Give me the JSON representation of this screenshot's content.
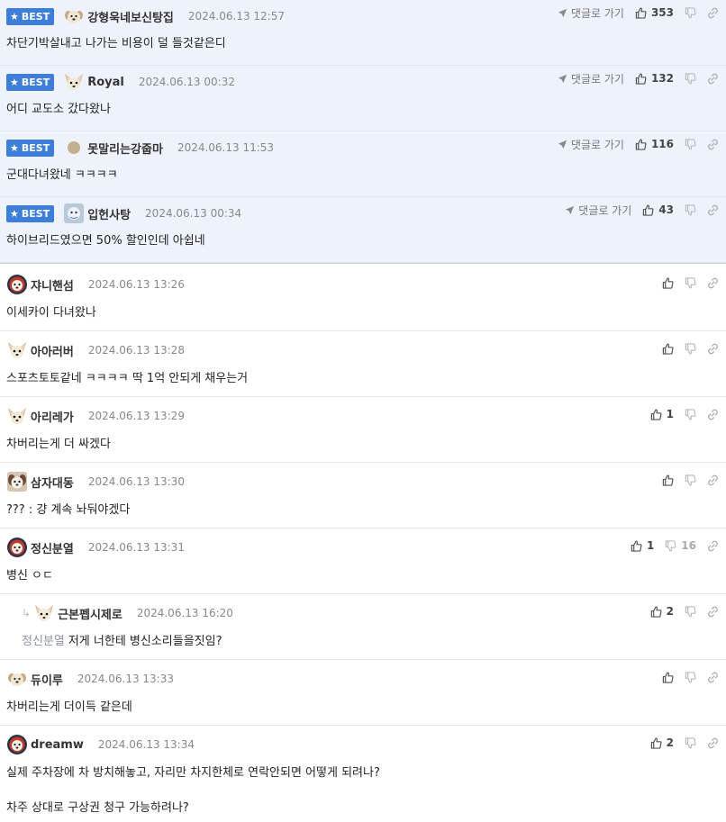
{
  "best_badge": "BEST",
  "goto_reply_label": "댓글로 가기",
  "best_comments": [
    {
      "nick": "강형욱네보신탕집",
      "date": "2024.06.13 12:57",
      "text": "차단기박살내고 나가는 비용이 덜 들것같은디",
      "likes": "353",
      "avatar": "puppy-avatar"
    },
    {
      "nick": "Royal",
      "date": "2024.06.13 00:32",
      "text": "어디 교도소 갔다왔나",
      "likes": "132",
      "avatar": "chihuahua-avatar"
    },
    {
      "nick": "못말리는강줍마",
      "date": "2024.06.13 11:53",
      "text": "군대다녀왔네 ㅋㅋㅋㅋ",
      "likes": "116",
      "avatar": "circle-avatar"
    },
    {
      "nick": "입헌사탕",
      "date": "2024.06.13 00:34",
      "text": "하이브리드였으면 50% 할인인데 아쉽네",
      "likes": "43",
      "avatar": "photo-avatar"
    }
  ],
  "comments": [
    {
      "nick": "쟈니핸섬",
      "date": "2024.06.13 13:26",
      "text": "이세카이 다녀왔나",
      "likes": "",
      "dislikes": "",
      "avatar": "lion-avatar"
    },
    {
      "nick": "아아러버",
      "date": "2024.06.13 13:28",
      "text": "스포츠토토같네 ㅋㅋㅋㅋ 딱 1억 안되게 채우는거",
      "likes": "",
      "dislikes": "",
      "avatar": "chihuahua-avatar"
    },
    {
      "nick": "아리레가",
      "date": "2024.06.13 13:29",
      "text": "차버리는게 더 싸겠다",
      "likes": "1",
      "dislikes": "",
      "avatar": "chihuahua-avatar"
    },
    {
      "nick": "삼자대동",
      "date": "2024.06.13 13:30",
      "text": "??? : 걍 계속 놔둬야겠다",
      "likes": "",
      "dislikes": "",
      "avatar": "dog-photo-avatar"
    },
    {
      "nick": "정신분열",
      "date": "2024.06.13 13:31",
      "text": "병신 ㅇㄷ",
      "likes": "1",
      "dislikes": "16",
      "avatar": "lion-avatar"
    },
    {
      "nick": "근본펩시제로",
      "date": "2024.06.13 16:20",
      "text": "저게 너한테 병신소리들을짓임?",
      "mention": "정신분열",
      "likes": "2",
      "dislikes": "",
      "avatar": "chihuahua-avatar",
      "reply": true
    },
    {
      "nick": "듀이루",
      "date": "2024.06.13 13:33",
      "text": "차버리는게 더이득 같은데",
      "likes": "",
      "dislikes": "",
      "avatar": "puppy-avatar"
    },
    {
      "nick": "dreamw",
      "date": "2024.06.13 13:34",
      "text": "실제 주차장에 차 방치해놓고, 자리만 차지한체로 연락안되면 어떻게 되려나?",
      "text2": "차주 상대로 구상권 청구 가능하려나?",
      "likes": "2",
      "dislikes": "",
      "avatar": "lion-avatar"
    }
  ],
  "colors": {
    "best_bg": "#eef3fb",
    "badge": "#3d7fd8",
    "border": "#e4e7ed"
  }
}
